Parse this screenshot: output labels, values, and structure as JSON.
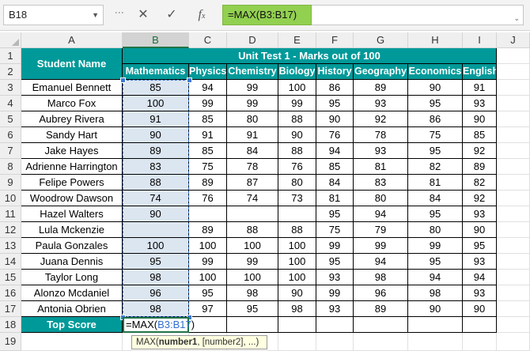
{
  "name_box": "B18",
  "formula_bar": {
    "prefix": "=MAX(",
    "ref": "B3:B17",
    "suffix": ")"
  },
  "columns": [
    "A",
    "B",
    "C",
    "D",
    "E",
    "F",
    "G",
    "H",
    "I",
    "J"
  ],
  "header": {
    "student_name": "Student Name",
    "title": "Unit Test 1 - Marks out of 100",
    "subjects": [
      "Mathematics",
      "Physics",
      "Chemistry",
      "Biology",
      "History",
      "Geography",
      "Economics",
      "English"
    ]
  },
  "rows": [
    {
      "name": "Emanuel Bennett",
      "marks": [
        "85",
        "94",
        "99",
        "100",
        "86",
        "89",
        "90",
        "91"
      ]
    },
    {
      "name": "Marco Fox",
      "marks": [
        "100",
        "99",
        "99",
        "99",
        "95",
        "93",
        "95",
        "93"
      ]
    },
    {
      "name": "Aubrey Rivera",
      "marks": [
        "91",
        "85",
        "80",
        "88",
        "90",
        "92",
        "86",
        "90"
      ]
    },
    {
      "name": "Sandy Hart",
      "marks": [
        "90",
        "91",
        "91",
        "90",
        "76",
        "78",
        "75",
        "85"
      ]
    },
    {
      "name": "Jake Hayes",
      "marks": [
        "89",
        "85",
        "84",
        "88",
        "94",
        "93",
        "95",
        "92"
      ]
    },
    {
      "name": "Adrienne Harrington",
      "marks": [
        "83",
        "75",
        "78",
        "76",
        "85",
        "81",
        "82",
        "89"
      ]
    },
    {
      "name": "Felipe Powers",
      "marks": [
        "88",
        "89",
        "87",
        "80",
        "84",
        "83",
        "81",
        "82"
      ]
    },
    {
      "name": "Woodrow Dawson",
      "marks": [
        "74",
        "76",
        "74",
        "73",
        "81",
        "80",
        "84",
        "92"
      ]
    },
    {
      "name": "Hazel Walters",
      "marks": [
        "90",
        "",
        "",
        "",
        "95",
        "94",
        "95",
        "93"
      ]
    },
    {
      "name": "Lula Mckenzie",
      "marks": [
        "",
        "89",
        "88",
        "88",
        "75",
        "79",
        "80",
        "90"
      ]
    },
    {
      "name": "Paula Gonzales",
      "marks": [
        "100",
        "100",
        "100",
        "100",
        "99",
        "99",
        "99",
        "95"
      ]
    },
    {
      "name": "Juana Dennis",
      "marks": [
        "95",
        "99",
        "99",
        "100",
        "95",
        "94",
        "95",
        "93"
      ]
    },
    {
      "name": "Taylor Long",
      "marks": [
        "98",
        "100",
        "100",
        "100",
        "93",
        "98",
        "94",
        "94"
      ]
    },
    {
      "name": "Alonzo Mcdaniel",
      "marks": [
        "96",
        "95",
        "98",
        "90",
        "99",
        "96",
        "98",
        "93"
      ]
    },
    {
      "name": "Antonia Obrien",
      "marks": [
        "98",
        "97",
        "95",
        "98",
        "93",
        "89",
        "90",
        "90"
      ]
    }
  ],
  "top_score_label": "Top Score",
  "edit_cell": {
    "prefix": "=MAX(",
    "ref": "B3:B17",
    "suffix": ")"
  },
  "tooltip": {
    "func": "MAX(",
    "arg1": "number1",
    "rest": ", [number2], ...)"
  },
  "colors": {
    "teal": "#009999",
    "formula_highlight": "#92d050",
    "selection": "#3e78d4"
  }
}
